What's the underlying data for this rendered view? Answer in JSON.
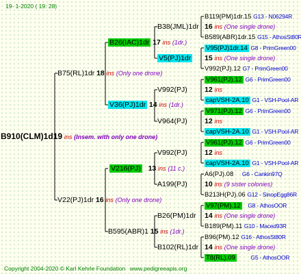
{
  "header": {
    "date": "19-  1-2020  ( 19: 28)"
  },
  "footer": {
    "copyright": "Copyright 2004-2020 © Karl Kehrle Foundation",
    "site": "www.pedigreeapis.org"
  },
  "root": {
    "name": "B910(CLM)1d",
    "num": "19",
    "ins": "ins",
    "note": "(Insem. with only one drone)"
  },
  "gen1": [
    {
      "name": "B75(RL)1dr",
      "num": "18",
      "ins": "ins",
      "note": "(Only one drone)"
    },
    {
      "name": "V22(PJ)1dr",
      "num": "16",
      "ins": "ins",
      "note": "(Only one drone)"
    }
  ],
  "gen2": [
    {
      "name": "B26(IAC)1dr",
      "num": "17",
      "ins": "ins",
      "note": "(1dr.)"
    },
    {
      "name": "V36(PJ)1dr",
      "num": "14",
      "ins": "ins",
      "note": "(1dr.)"
    },
    {
      "name": "V216(PJ)",
      "num": "13",
      "ins": "ins",
      "note": "(11 c.)"
    },
    {
      "name": "B595(ABR)1",
      "num": "15",
      "ins": "ins",
      "note": "(1dr.)"
    }
  ],
  "gen3": [
    {
      "name": "B38(JML)1dr",
      "num": "16",
      "ins": "ins",
      "note": "(One single drone)"
    },
    {
      "name": "V5(PJ)1dr",
      "num": "15",
      "ins": "ins",
      "note": "(One single drone)"
    },
    {
      "name": "V992(PJ)",
      "num": "12",
      "ins": "ins"
    },
    {
      "name": "V964(PJ)",
      "num": "12",
      "ins": "ins"
    },
    {
      "name": "V992(PJ)",
      "num": "12",
      "ins": "ins"
    },
    {
      "name": "A199(PJ)",
      "num": "10",
      "ins": "ins",
      "note": "(9 sister colonies)"
    },
    {
      "name": "B26(PM)1dr",
      "num": "14",
      "ins": "ins",
      "note": "(One single drone)"
    },
    {
      "name": "B102(RL)1dr",
      "num": "14",
      "ins": "ins",
      "note": "(One single drone)"
    }
  ],
  "gen4": [
    {
      "name": "B119(PM)1dr.15",
      "src": "G13 - N06294R"
    },
    {
      "name": "B589(ABR)1dr.15",
      "src": "G15 - AthosSt80R"
    },
    {
      "name": "V95(PJ)1dr.14",
      "src": "G8 - PrimGreen00"
    },
    {
      "name": "V992(PJ).12",
      "src": "G7 - PrimGreen00"
    },
    {
      "name": "V961(PJ).12",
      "src": "G6 - PrimGreen00"
    },
    {
      "name": "capVSH-2A.10",
      "src": "G1 - VSH-Pool-AR"
    },
    {
      "name": "V971(PJ).12",
      "src": "G6 - PrimGreen00"
    },
    {
      "name": "capVSH-2A.10",
      "src": "G1 - VSH-Pool-AR"
    },
    {
      "name": "V961(PJ).12",
      "src": "G6 - PrimGreen00"
    },
    {
      "name": "capVSH-2A.10",
      "src": "G1 - VSH-Pool-AR"
    },
    {
      "name": "A6(PJ).08",
      "src": "G6 - Cankin97Q"
    },
    {
      "name": "B213H(PJ).06",
      "src": "G12 - SinopEgg86R"
    },
    {
      "name": "V97(PM).12",
      "src": "G8 - AthosOOR"
    },
    {
      "name": "B189(PM).11",
      "src": "G10 - Maced93R"
    },
    {
      "name": "B96(PM).12",
      "src": "G16 - AthosSt80R"
    },
    {
      "name": "T8(RL).09",
      "src": "G5 - AthosOOR"
    }
  ]
}
